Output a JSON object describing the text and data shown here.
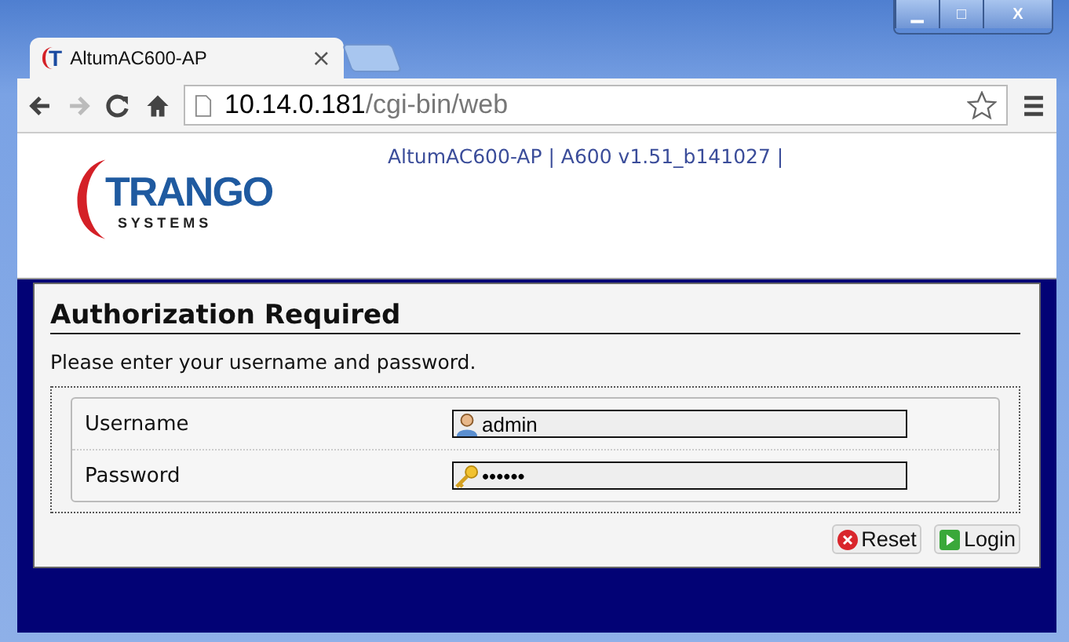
{
  "window": {
    "controls": [
      "▁",
      "□",
      "X"
    ]
  },
  "tabs": [
    {
      "favicon": "T",
      "label": "AltumAC600-AP",
      "close": "×",
      "selected": true
    },
    {
      "kind": "new",
      "selected": false
    }
  ],
  "address": {
    "host": "10.14.0.181",
    "path": "/cgi-bin/web"
  },
  "header": {
    "logo": {
      "name": "TRANGO",
      "sub": "S Y S T E M S"
    },
    "info": "AltumAC600-AP | A600 v1.51_b141027 |"
  },
  "login": {
    "title": "Authorization Required",
    "message": "Please enter your username and password.",
    "fields": [
      {
        "label": "Username",
        "kind": "user",
        "value": "admin"
      },
      {
        "label": "Password",
        "kind": "key",
        "value": "••••••"
      }
    ],
    "buttons": [
      {
        "label": "Reset",
        "kind": "reset"
      },
      {
        "label": "Login",
        "kind": "login"
      }
    ]
  }
}
